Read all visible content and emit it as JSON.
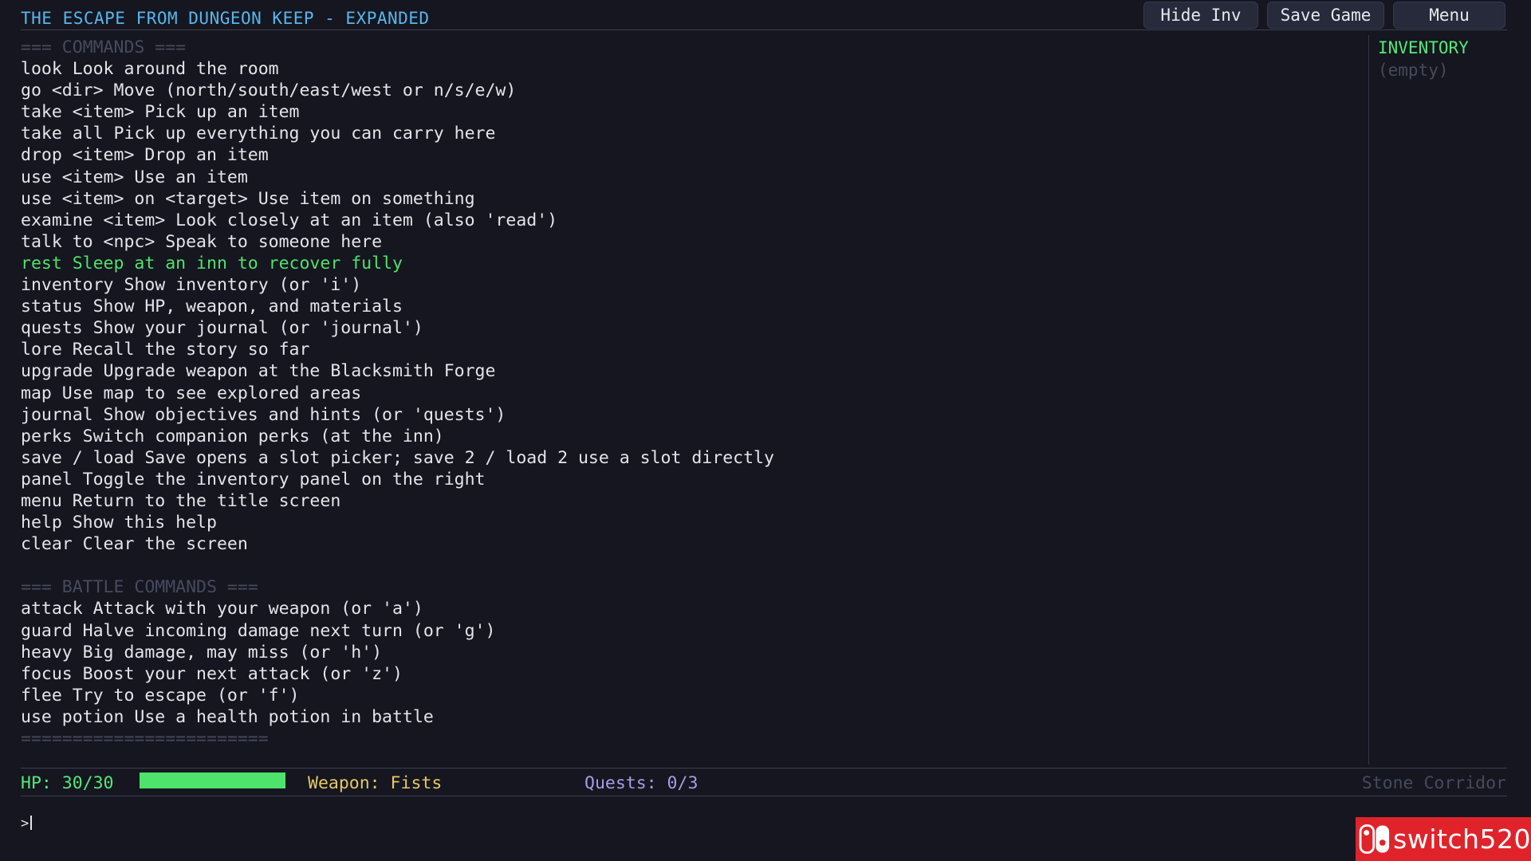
{
  "title": "THE ESCAPE FROM DUNGEON KEEP - EXPANDED",
  "buttons": {
    "hide_inv": "Hide Inv",
    "save_game": "Save Game",
    "menu": "Menu"
  },
  "log": [
    {
      "text": "=== COMMANDS ===",
      "style": "header"
    },
    {
      "text": "look Look around the room"
    },
    {
      "text": "go <dir> Move (north/south/east/west or n/s/e/w)"
    },
    {
      "text": "take <item> Pick up an item"
    },
    {
      "text": "take all Pick up everything you can carry here"
    },
    {
      "text": "drop <item> Drop an item"
    },
    {
      "text": "use <item> Use an item"
    },
    {
      "text": "use <item> on <target> Use item on something"
    },
    {
      "text": "examine <item> Look closely at an item (also 'read')"
    },
    {
      "text": "talk to <npc> Speak to someone here"
    },
    {
      "text": "rest Sleep at an inn to recover fully",
      "style": "hl"
    },
    {
      "text": "inventory Show inventory (or 'i')"
    },
    {
      "text": "status Show HP, weapon, and materials"
    },
    {
      "text": "quests Show your journal (or 'journal')"
    },
    {
      "text": "lore Recall the story so far"
    },
    {
      "text": "upgrade Upgrade weapon at the Blacksmith Forge"
    },
    {
      "text": "map Use map to see explored areas"
    },
    {
      "text": "journal Show objectives and hints (or 'quests')"
    },
    {
      "text": "perks Switch companion perks (at the inn)"
    },
    {
      "text": "save / load Save opens a slot picker; save 2 / load 2 use a slot directly"
    },
    {
      "text": "panel Toggle the inventory panel on the right"
    },
    {
      "text": "menu Return to the title screen"
    },
    {
      "text": "help Show this help"
    },
    {
      "text": "clear Clear the screen"
    },
    {
      "text": ""
    },
    {
      "text": "=== BATTLE COMMANDS ===",
      "style": "header"
    },
    {
      "text": "attack Attack with your weapon (or 'a')"
    },
    {
      "text": "guard Halve incoming damage next turn (or 'g')"
    },
    {
      "text": "heavy Big damage, may miss (or 'h')"
    },
    {
      "text": "focus Boost your next attack (or 'z')"
    },
    {
      "text": "flee Try to escape (or 'f')"
    },
    {
      "text": "use potion Use a health potion in battle"
    },
    {
      "text": "========================",
      "style": "header"
    }
  ],
  "inventory": {
    "title": "INVENTORY",
    "empty_text": "(empty)"
  },
  "status": {
    "hp_text": "HP: 30/30",
    "hp_fraction": 1.0,
    "weapon_text": "Weapon: Fists",
    "quests_text": "Quests: 0/3",
    "location": "Stone Corridor"
  },
  "prompt": ">",
  "watermark": {
    "text": "switch520"
  },
  "colors": {
    "background": "#15161f",
    "title": "#56b6ee",
    "highlight": "#4ee36a",
    "weapon": "#e5c866",
    "quests": "#a99be6",
    "watermark_bg": "#e0232b"
  }
}
